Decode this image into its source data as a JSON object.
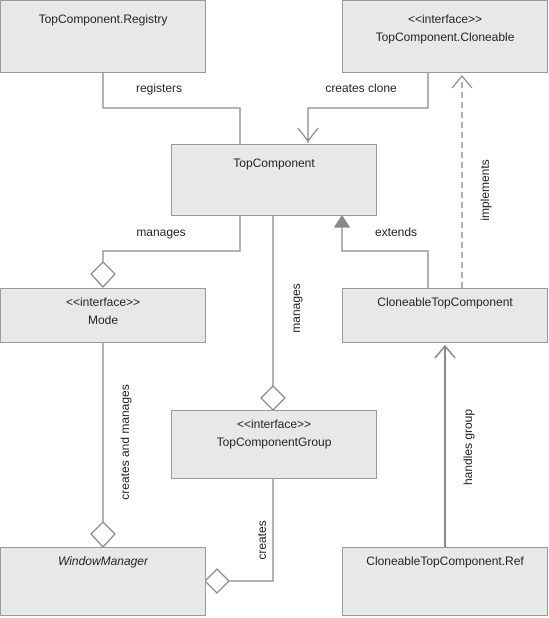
{
  "colors": {
    "box_fill": "#e8e8e8",
    "border": "#9a9a9a",
    "line": "#888888",
    "text": "#222222"
  },
  "boxes": {
    "registry": {
      "name": "TopComponent.Registry"
    },
    "cloneable": {
      "stereotype": "<<interface>>",
      "name": "TopComponent.Cloneable"
    },
    "topcomponent": {
      "name": "TopComponent"
    },
    "mode": {
      "stereotype": "<<interface>>",
      "name": "Mode"
    },
    "cloneable_tc": {
      "name": "CloneableTopComponent"
    },
    "group": {
      "stereotype": "<<interface>>",
      "name": "TopComponentGroup"
    },
    "window_manager": {
      "name": "WindowManager"
    },
    "ref": {
      "name": "CloneableTopComponent.Ref"
    }
  },
  "relations": {
    "registers": "registers",
    "creates_clone": "creates clone",
    "implements": "implements",
    "manages_mode": "manages",
    "extends": "extends",
    "manages_group": "manages",
    "creates_and_manages": "creates and manages",
    "creates": "creates",
    "handles_group": "handles group"
  }
}
